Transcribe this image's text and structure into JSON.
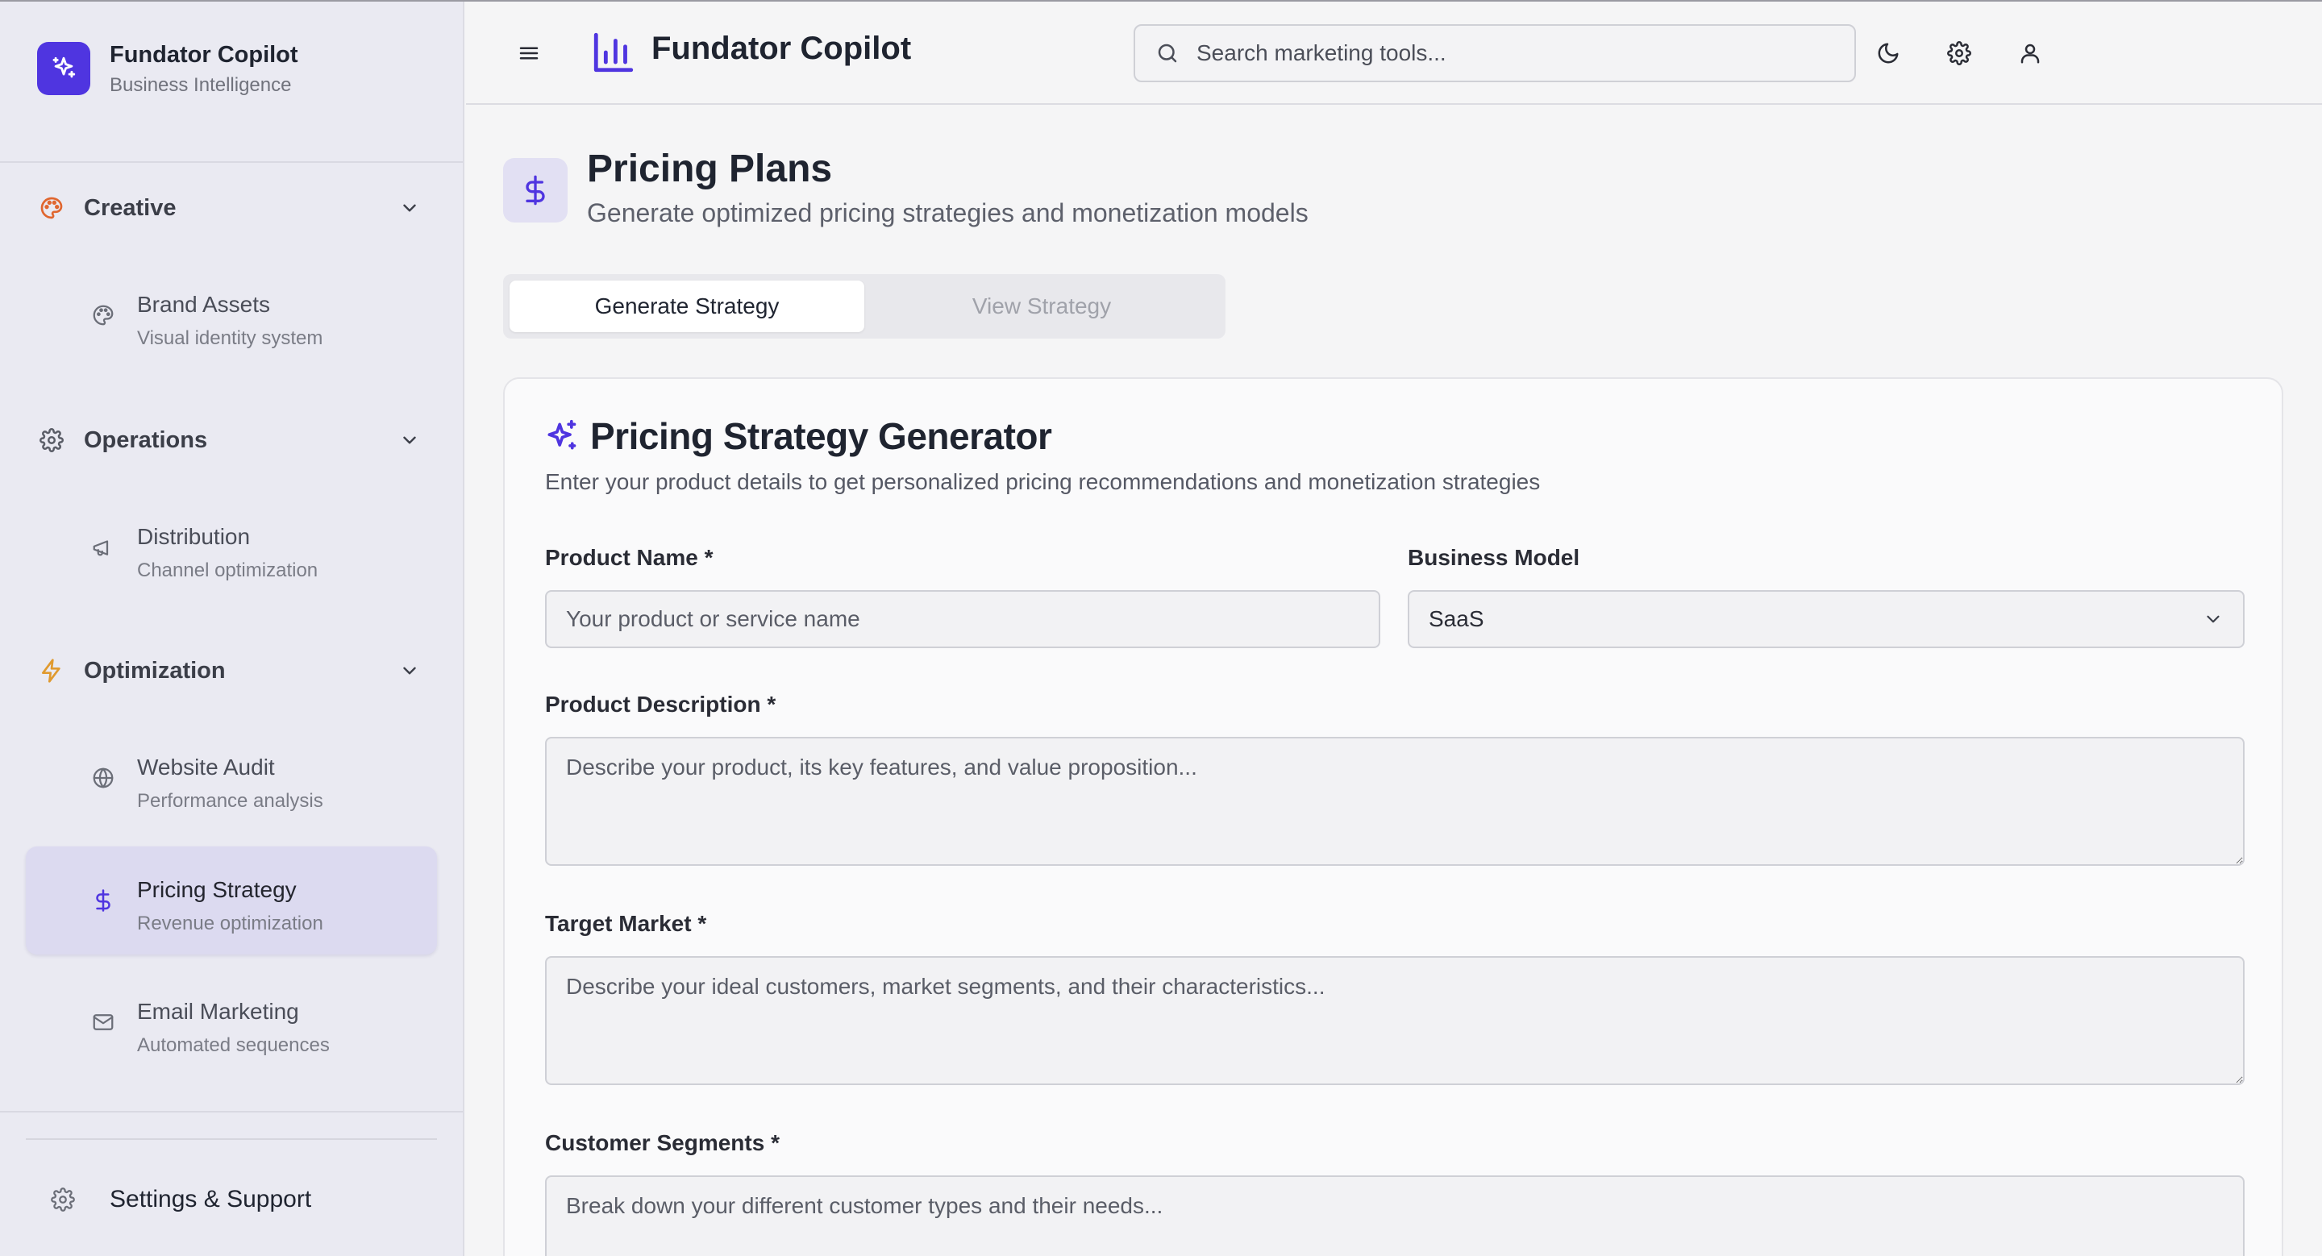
{
  "brand": {
    "title": "Fundator Copilot",
    "subtitle": "Business Intelligence",
    "accent": "#4f35e0"
  },
  "sidebar": {
    "groups": [
      {
        "label": "Creative",
        "icon": "palette-icon",
        "icon_color": "#e0662f",
        "items": [
          {
            "title": "Brand Assets",
            "subtitle": "Visual identity system",
            "icon": "palette-icon"
          }
        ]
      },
      {
        "label": "Operations",
        "icon": "gear-icon",
        "icon_color": "#5a5d67",
        "items": [
          {
            "title": "Distribution",
            "subtitle": "Channel optimization",
            "icon": "megaphone-icon"
          }
        ]
      },
      {
        "label": "Optimization",
        "icon": "bolt-icon",
        "icon_color": "#e09a2f",
        "items": [
          {
            "title": "Website Audit",
            "subtitle": "Performance analysis",
            "icon": "globe-icon"
          },
          {
            "title": "Pricing Strategy",
            "subtitle": "Revenue optimization",
            "icon": "dollar-icon",
            "active": true
          },
          {
            "title": "Email Marketing",
            "subtitle": "Automated sequences",
            "icon": "mail-icon"
          }
        ]
      }
    ],
    "footer": {
      "label": "Settings & Support",
      "icon": "gear-icon"
    }
  },
  "topbar": {
    "title": "Fundator Copilot",
    "search_placeholder": "Search marketing tools...",
    "actions": [
      "moon-icon",
      "gear-icon",
      "user-icon"
    ]
  },
  "page": {
    "title": "Pricing Plans",
    "subtitle": "Generate optimized pricing strategies and monetization models",
    "icon": "dollar-icon",
    "tabs": [
      {
        "label": "Generate Strategy",
        "active": true
      },
      {
        "label": "View Strategy",
        "active": false
      }
    ]
  },
  "form": {
    "title": "Pricing Strategy Generator",
    "description": "Enter your product details to get personalized pricing recommendations and monetization strategies",
    "product_name": {
      "label": "Product Name *",
      "placeholder": "Your product or service name",
      "value": ""
    },
    "business_model": {
      "label": "Business Model",
      "value": "SaaS"
    },
    "product_description": {
      "label": "Product Description *",
      "placeholder": "Describe your product, its key features, and value proposition..."
    },
    "target_market": {
      "label": "Target Market *",
      "placeholder": "Describe your ideal customers, market segments, and their characteristics..."
    },
    "customer_segments": {
      "label": "Customer Segments *",
      "placeholder": "Break down your different customer types and their needs..."
    }
  }
}
